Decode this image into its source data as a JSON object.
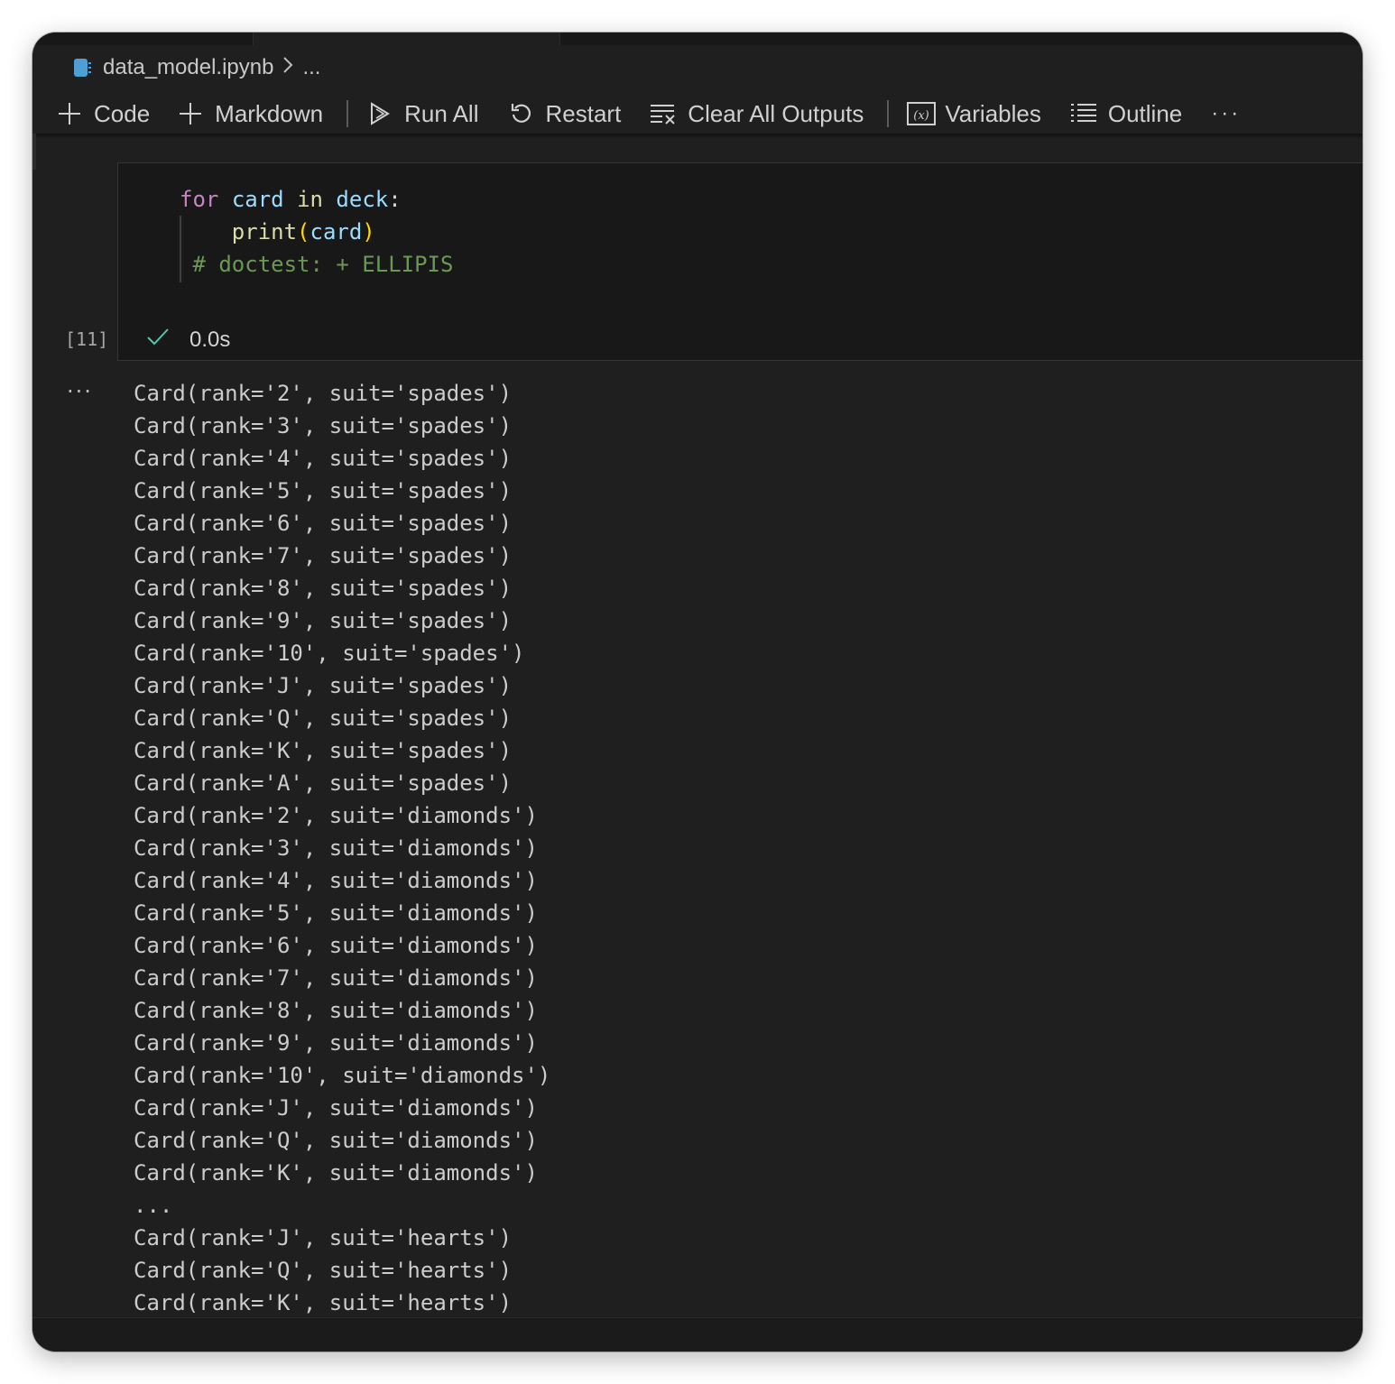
{
  "file": {
    "name": "data_model.ipynb",
    "more": "..."
  },
  "toolbar": {
    "code": "Code",
    "markdown": "Markdown",
    "run_all": "Run All",
    "restart": "Restart",
    "clear_all_outputs": "Clear All Outputs",
    "variables": "Variables",
    "outline": "Outline",
    "more": "···"
  },
  "cell": {
    "line1": {
      "kw1": "for",
      "var1": "card",
      "kw2": "in",
      "var2": "deck",
      "colon": ":"
    },
    "line2": {
      "fn": "print",
      "open": "(",
      "arg": "card",
      "close": ")"
    },
    "line3": "# doctest: + ELLIPIS",
    "execution_count": "[11]",
    "duration": "0.0s",
    "status": "success"
  },
  "output": {
    "more": "···",
    "lines": [
      "Card(rank='2', suit='spades')",
      "Card(rank='3', suit='spades')",
      "Card(rank='4', suit='spades')",
      "Card(rank='5', suit='spades')",
      "Card(rank='6', suit='spades')",
      "Card(rank='7', suit='spades')",
      "Card(rank='8', suit='spades')",
      "Card(rank='9', suit='spades')",
      "Card(rank='10', suit='spades')",
      "Card(rank='J', suit='spades')",
      "Card(rank='Q', suit='spades')",
      "Card(rank='K', suit='spades')",
      "Card(rank='A', suit='spades')",
      "Card(rank='2', suit='diamonds')",
      "Card(rank='3', suit='diamonds')",
      "Card(rank='4', suit='diamonds')",
      "Card(rank='5', suit='diamonds')",
      "Card(rank='6', suit='diamonds')",
      "Card(rank='7', suit='diamonds')",
      "Card(rank='8', suit='diamonds')",
      "Card(rank='9', suit='diamonds')",
      "Card(rank='10', suit='diamonds')",
      "Card(rank='J', suit='diamonds')",
      "Card(rank='Q', suit='diamonds')",
      "Card(rank='K', suit='diamonds')",
      "...",
      "Card(rank='J', suit='hearts')",
      "Card(rank='Q', suit='hearts')",
      "Card(rank='K', suit='hearts')"
    ]
  },
  "icons": {
    "notebook": "notebook-icon",
    "breadcrumb_sep": "chevron-right-icon",
    "code": "plus-icon",
    "markdown": "plus-icon",
    "run_all": "run-all-icon",
    "restart": "restart-icon",
    "clear_all_outputs": "clear-all-icon",
    "variables": "variables-icon",
    "outline": "outline-icon",
    "success": "check-icon"
  },
  "colors": {
    "background": "#1f1f1f",
    "cell_background": "#181818",
    "keyword": "#c586c0",
    "variable": "#9cdcfe",
    "function": "#dcdcaa",
    "bracket": "#ffd700",
    "comment": "#6a9955",
    "success": "#4ec9b0",
    "notebook_icon": "#4d9fd4"
  }
}
